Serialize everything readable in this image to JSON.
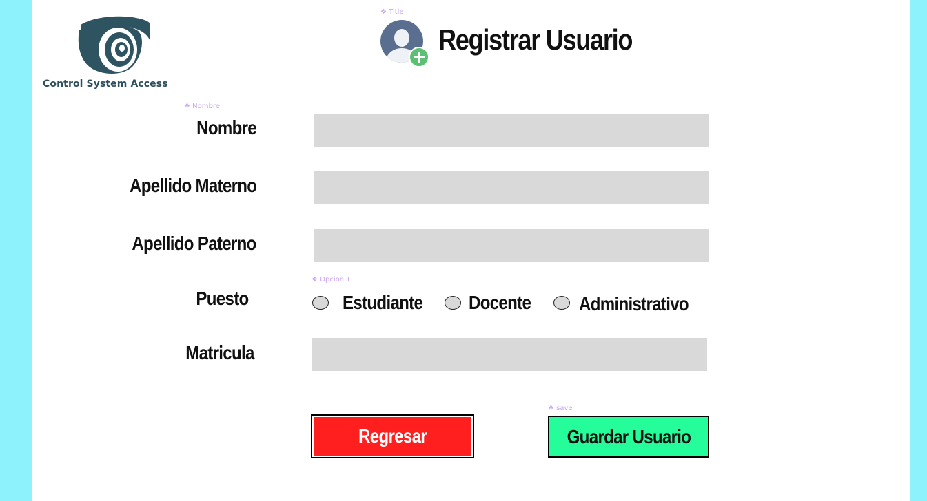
{
  "colors": {
    "page_background": "#8ef2fd",
    "panel_background": "#ffffff",
    "input_fill": "#d9d9d9",
    "back_button": "#ff1f1f",
    "save_button": "#25fd9a",
    "component_label": "#c9a6f2",
    "avatar_plus": "#5cbf73"
  },
  "logo": {
    "icon": "security-camera-icon",
    "text": "Control System Access"
  },
  "component_labels": {
    "title": "❖ Title",
    "nombre": "❖ Nombre",
    "opcion": "❖ Opcion 1",
    "save": "❖ save"
  },
  "header": {
    "avatar_icon": "add-user-icon",
    "title": "Registrar Usuario"
  },
  "form": {
    "nombre": {
      "label": "Nombre",
      "value": "",
      "placeholder": ""
    },
    "apellido_materno": {
      "label": "Apellido Materno",
      "value": "",
      "placeholder": ""
    },
    "apellido_paterno": {
      "label": "Apellido Paterno",
      "value": "",
      "placeholder": ""
    },
    "puesto": {
      "label": "Puesto",
      "options": [
        "Estudiante",
        "Docente",
        "Administrativo"
      ],
      "selected": ""
    },
    "matricula": {
      "label": "Matricula",
      "value": "",
      "placeholder": ""
    }
  },
  "buttons": {
    "back": "Regresar",
    "save": "Guardar Usuario"
  }
}
